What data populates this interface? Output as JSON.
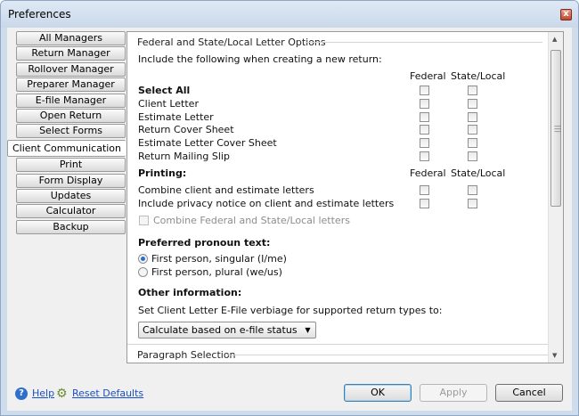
{
  "window": {
    "title": "Preferences",
    "close_glyph": "x"
  },
  "nav": {
    "items": [
      {
        "label": "All Managers"
      },
      {
        "label": "Return Manager"
      },
      {
        "label": "Rollover Manager"
      },
      {
        "label": "Preparer Manager"
      },
      {
        "label": "E-file Manager"
      },
      {
        "label": "Open Return"
      },
      {
        "label": "Select Forms"
      },
      {
        "label": "Client Communication",
        "selected": true
      },
      {
        "label": "Print"
      },
      {
        "label": "Form Display"
      },
      {
        "label": "Updates"
      },
      {
        "label": "Calculator"
      },
      {
        "label": "Backup"
      }
    ]
  },
  "content": {
    "section_title": "Federal and State/Local Letter Options",
    "intro": "Include the following when creating a new return:",
    "col_federal": "Federal",
    "col_state": "State/Local",
    "select_all": "Select All",
    "letters": [
      "Client Letter",
      "Estimate Letter",
      "Return Cover Sheet",
      "Estimate Letter Cover Sheet",
      "Return Mailing Slip"
    ],
    "printing_heading": "Printing:",
    "printing_options": [
      "Combine client and estimate letters",
      "Include privacy notice on client and estimate letters"
    ],
    "combine_fed_state": "Combine Federal and State/Local letters",
    "pronoun_heading": "Preferred pronoun text:",
    "pronoun_options": [
      {
        "label": "First person, singular (I/me)",
        "selected": true
      },
      {
        "label": "First person, plural (we/us)",
        "selected": false
      }
    ],
    "other_heading": "Other information:",
    "efile_verbiage_label": "Set Client Letter E-File verbiage for supported return types to:",
    "efile_dropdown_value": "Calculate based on e-file status",
    "next_section_title": "Paragraph Selection"
  },
  "footer": {
    "help_label": "Help",
    "reset_label": "Reset Defaults",
    "ok_label": "OK",
    "apply_label": "Apply",
    "cancel_label": "Cancel"
  }
}
